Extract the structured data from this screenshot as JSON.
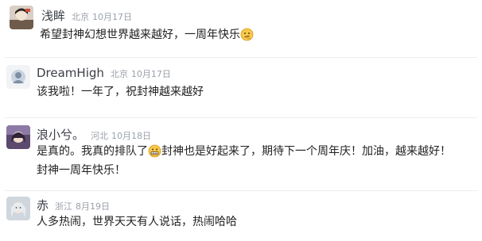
{
  "comments": [
    {
      "username": "浅眸",
      "location": "北京",
      "date": "10月17日",
      "text": "希望封神幻想世界越来越好，一周年快乐",
      "emoji": "thinking-face-emoji"
    },
    {
      "username": "DreamHigh",
      "location": "北京",
      "date": "10月17日",
      "text": "该我啦！一年了，祝封神越来越好"
    },
    {
      "username": "浪小兮。",
      "location": "河北",
      "date": "10月18日",
      "text_before": "是真的。我真的排队了",
      "emoji": "grimacing-face-emoji",
      "text_after": "封神也是好起来了，期待下一个周年庆！加油，越来越好！",
      "text_line2": "封神一周年快乐！"
    },
    {
      "username": "赤",
      "location": "浙江",
      "date": "8月19日",
      "text": "人多热闹，世界天天有人说话，热闹哈哈"
    }
  ],
  "colors": {
    "username": "#3a3f47",
    "meta": "#9aa1aa",
    "text": "#222222",
    "divider": "#eceef1"
  }
}
